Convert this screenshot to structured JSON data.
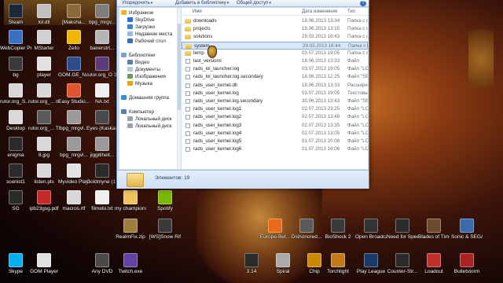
{
  "window": {
    "toolbar": {
      "organize": "Упорядочить",
      "add_to_library": "Добавить в библиотеку",
      "share": "Общий доступ",
      "help": "?"
    },
    "nav": [
      {
        "label": "Избранное",
        "icon": "star-icon",
        "color": "#e8b730",
        "indent": 0
      },
      {
        "label": "SkyDrive",
        "icon": "cloud-icon",
        "color": "#2b6bd4",
        "indent": 1
      },
      {
        "label": "Загрузки",
        "icon": "downloads-icon",
        "color": "#3f7fcf",
        "indent": 1
      },
      {
        "label": "Недавние места",
        "icon": "recent-places-icon",
        "color": "#9bb9dc",
        "indent": 1
      },
      {
        "label": "Рабочий стол",
        "icon": "desktop-icon",
        "color": "#3c6fb6",
        "indent": 1
      },
      {
        "label": "Библиотеки",
        "icon": "libraries-icon",
        "color": "#7aa0cc",
        "indent": 0
      },
      {
        "label": "Видео",
        "icon": "video-icon",
        "color": "#5e7fa8",
        "indent": 1
      },
      {
        "label": "Документы",
        "icon": "documents-icon",
        "color": "#b9c7d8",
        "indent": 1
      },
      {
        "label": "Изображения",
        "icon": "images-icon",
        "color": "#6d9b5c",
        "indent": 1
      },
      {
        "label": "Музыка",
        "icon": "music-icon",
        "color": "#e3a21a",
        "indent": 1
      },
      {
        "label": "Домашняя группа",
        "icon": "homegroup-icon",
        "color": "#3a8fd6",
        "indent": 0
      },
      {
        "label": "Компьютер",
        "icon": "computer-icon",
        "color": "#5b7fae",
        "indent": 0
      },
      {
        "label": "Локальный диск",
        "icon": "drive-icon",
        "color": "#9aa4ae",
        "indent": 1
      },
      {
        "label": "Локальный диск",
        "icon": "drive-icon",
        "color": "#9aa4ae",
        "indent": 1
      }
    ],
    "columns": {
      "name": "Имя",
      "date": "Дата изменения",
      "type": "Тип"
    },
    "files": [
      {
        "name": "downloads",
        "date": "18.06.2013 13:34",
        "type": "Папка с ф",
        "kind": "folder"
      },
      {
        "name": "projects",
        "date": "18.06.2013 13:15",
        "type": "Папка с ф",
        "kind": "folder"
      },
      {
        "name": "solutions",
        "date": "29.03.2013 16:43",
        "type": "Папка с ф",
        "kind": "folder"
      },
      {
        "name": "system",
        "date": "29.03.2013 16:44",
        "type": "Папка с ф",
        "kind": "folder",
        "selected": true
      },
      {
        "name": "temp",
        "date": "03.07.2013 19:05",
        "type": "Папка с ф",
        "kind": "folder"
      },
      {
        "name": "last_versions",
        "date": "18.06.2013 13:33",
        "type": "Файл",
        "kind": "file"
      },
      {
        "name": "rads_lol_launcher.log",
        "date": "03.07.2013 19:05",
        "type": "Файл \"LO",
        "kind": "file"
      },
      {
        "name": "rads_lol_launcher.log.secondary",
        "date": "18.06.2013 12:25",
        "type": "Файл \"SEC",
        "kind": "file"
      },
      {
        "name": "rads_user_kernel.dll",
        "date": "18.06.2013 13:33",
        "type": "Расшире",
        "kind": "file"
      },
      {
        "name": "rads_user_kernel.log",
        "date": "03.07.2013 19:05",
        "type": "Текстовы",
        "kind": "file"
      },
      {
        "name": "rads_user_kernel.log.secondary",
        "date": "30.06.2013 13:43",
        "type": "Файл \"SEC",
        "kind": "file"
      },
      {
        "name": "rads_user_kernel.log1",
        "date": "02.07.2013 23:25",
        "type": "Файл \"LO",
        "kind": "file"
      },
      {
        "name": "rads_user_kernel.log2",
        "date": "02.07.2013 13:49",
        "type": "Файл \"LO",
        "kind": "file"
      },
      {
        "name": "rads_user_kernel.log3",
        "date": "02.07.2013 13:35",
        "type": "Файл \"LO",
        "kind": "file"
      },
      {
        "name": "rads_user_kernel.log4",
        "date": "02.07.2013 13:05",
        "type": "Файл \"LO",
        "kind": "file"
      },
      {
        "name": "rads_user_kernel.log5",
        "date": "01.07.2013 20:08",
        "type": "Файл \"LO",
        "kind": "file"
      },
      {
        "name": "rads_user_kernel.log6",
        "date": "01.07.2013 16:06",
        "type": "Файл \"LO",
        "kind": "file"
      }
    ],
    "status": {
      "count": "Элементов: 19"
    }
  },
  "desktop_icons": [
    {
      "label": "Steam",
      "color": "#1b2838"
    },
    {
      "label": "lol.dll",
      "color": "#c0c0c0"
    },
    {
      "label": "[Maksha...",
      "color": "#8a6a3a"
    },
    {
      "label": "bpg_mrgv...",
      "color": "#7e7e7e"
    },
    {
      "label": "WebCopier Pro",
      "color": "#3b6fc1"
    },
    {
      "label": "MStarter",
      "color": "#d0d0d0"
    },
    {
      "label": "Zello",
      "color": "#f2b705"
    },
    {
      "label": "banerstrt...",
      "color": "#b5b5b5"
    },
    {
      "label": "bg",
      "color": "#3a3a3a"
    },
    {
      "label": "player",
      "color": "#e2e2e2"
    },
    {
      "label": "GOM.GE_N...",
      "color": "#2d4d8a"
    },
    {
      "label": "rutor.org_O Зла Возвея",
      "color": "#5a3c7a"
    },
    {
      "label": "rutor.org_S... Бессмертн...",
      "color": "#d8d8d8"
    },
    {
      "label": "rutor.org_... по рисова...",
      "color": "#d8d8d8"
    },
    {
      "label": "Easy Studio...",
      "color": "#e0542d"
    },
    {
      "label": "NA.txt",
      "color": "#f0f0f0"
    },
    {
      "label": "Desktop",
      "color": "#d9d9d9"
    },
    {
      "label": "rutor.org_... The Menta...",
      "color": "#5b5b5b"
    },
    {
      "label": "bpg_mrgvl...",
      "color": "#9a9a9a"
    },
    {
      "label": "Eyes (Kaskade's...",
      "color": "#4a4a4a"
    },
    {
      "label": "enigma",
      "color": "#2a2a2a"
    },
    {
      "label": "8.jpg",
      "color": "#d8d8d8"
    },
    {
      "label": "bpg_mrgvl...",
      "color": "#9a9a9a"
    },
    {
      "label": "jiggitiheit...",
      "color": "#9a9a9a"
    },
    {
      "label": "scenist1",
      "color": "#2b2b2b"
    },
    {
      "label": "listen.pls",
      "color": "#d8d8d8"
    },
    {
      "label": "Myvideo Playlist",
      "color": "#e3e3e3"
    },
    {
      "label": "Goldmyne (1 .mkv 2012...",
      "color": "#2a2a2a"
    },
    {
      "label": "my champions",
      "color": "#efc45a"
    },
    {
      "label": "Spotify",
      "color": "#7ab800"
    },
    {
      "label": "SG",
      "color": "#2a2a2a"
    },
    {
      "label": "ipb23gsg.pdf",
      "color": "#c62828"
    },
    {
      "label": "macros.rtf",
      "color": "#d8d8d8"
    },
    {
      "label": "filmebi.txt",
      "color": "#f0f0f0"
    },
    {
      "label": "RealmFix.zip",
      "color": "#9e7e3e"
    },
    {
      "label": "[WS]Snow Rift] 21 S...",
      "color": "#3a3a3a"
    },
    {
      "label": "Europe-Bet...",
      "color": "#e76a1a"
    },
    {
      "label": "Dishonored...",
      "color": "#5a5a5a"
    },
    {
      "label": "BioShock 2",
      "color": "#3a3a3a"
    },
    {
      "label": "Open Broadcast...",
      "color": "#333333"
    },
    {
      "label": "Need for Speed Mos...",
      "color": "#2b2b2b"
    },
    {
      "label": "Blades of Time",
      "color": "#6a4a2a"
    },
    {
      "label": "Sonic & SEGA All-...",
      "color": "#3a6aaa"
    },
    {
      "label": "Skype",
      "color": "#00aff0"
    },
    {
      "label": "GOM Player",
      "color": "#e0e0e0"
    },
    {
      "label": "Any DVD",
      "color": "#4a4a4a"
    },
    {
      "label": "Twitch.exe",
      "color": "#6441a4"
    },
    {
      "label": "3.14",
      "color": "#2a2a2a"
    },
    {
      "label": "Spiral",
      "color": "#aaaaaa"
    },
    {
      "label": "Chip",
      "color": "#cc8800"
    },
    {
      "label": "Torchlight",
      "color": "#c47a1a"
    },
    {
      "label": "Play League",
      "color": "#1a3a6a"
    },
    {
      "label": "Counter-Str...",
      "color": "#2a2a2a"
    },
    {
      "label": "Loadout",
      "color": "#c0302a"
    },
    {
      "label": "Bulletstorm",
      "color": "#aa2222"
    }
  ]
}
